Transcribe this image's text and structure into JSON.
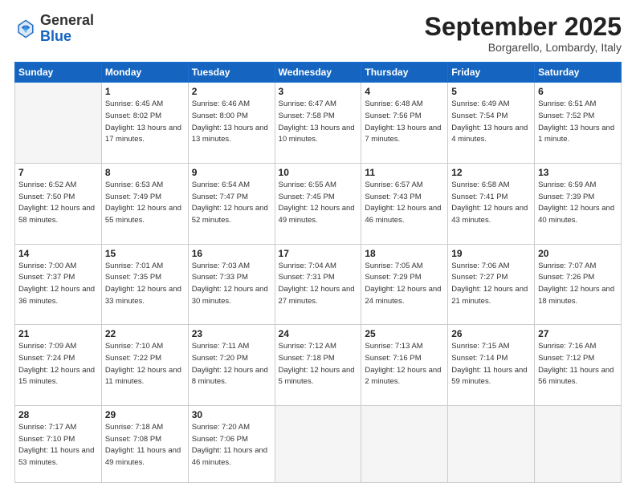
{
  "logo": {
    "text_general": "General",
    "text_blue": "Blue"
  },
  "title": "September 2025",
  "location": "Borgarello, Lombardy, Italy",
  "weekdays": [
    "Sunday",
    "Monday",
    "Tuesday",
    "Wednesday",
    "Thursday",
    "Friday",
    "Saturday"
  ],
  "weeks": [
    [
      {
        "day": "",
        "empty": true
      },
      {
        "day": "1",
        "sunrise": "Sunrise: 6:45 AM",
        "sunset": "Sunset: 8:02 PM",
        "daylight": "Daylight: 13 hours and 17 minutes."
      },
      {
        "day": "2",
        "sunrise": "Sunrise: 6:46 AM",
        "sunset": "Sunset: 8:00 PM",
        "daylight": "Daylight: 13 hours and 13 minutes."
      },
      {
        "day": "3",
        "sunrise": "Sunrise: 6:47 AM",
        "sunset": "Sunset: 7:58 PM",
        "daylight": "Daylight: 13 hours and 10 minutes."
      },
      {
        "day": "4",
        "sunrise": "Sunrise: 6:48 AM",
        "sunset": "Sunset: 7:56 PM",
        "daylight": "Daylight: 13 hours and 7 minutes."
      },
      {
        "day": "5",
        "sunrise": "Sunrise: 6:49 AM",
        "sunset": "Sunset: 7:54 PM",
        "daylight": "Daylight: 13 hours and 4 minutes."
      },
      {
        "day": "6",
        "sunrise": "Sunrise: 6:51 AM",
        "sunset": "Sunset: 7:52 PM",
        "daylight": "Daylight: 13 hours and 1 minute."
      }
    ],
    [
      {
        "day": "7",
        "sunrise": "Sunrise: 6:52 AM",
        "sunset": "Sunset: 7:50 PM",
        "daylight": "Daylight: 12 hours and 58 minutes."
      },
      {
        "day": "8",
        "sunrise": "Sunrise: 6:53 AM",
        "sunset": "Sunset: 7:49 PM",
        "daylight": "Daylight: 12 hours and 55 minutes."
      },
      {
        "day": "9",
        "sunrise": "Sunrise: 6:54 AM",
        "sunset": "Sunset: 7:47 PM",
        "daylight": "Daylight: 12 hours and 52 minutes."
      },
      {
        "day": "10",
        "sunrise": "Sunrise: 6:55 AM",
        "sunset": "Sunset: 7:45 PM",
        "daylight": "Daylight: 12 hours and 49 minutes."
      },
      {
        "day": "11",
        "sunrise": "Sunrise: 6:57 AM",
        "sunset": "Sunset: 7:43 PM",
        "daylight": "Daylight: 12 hours and 46 minutes."
      },
      {
        "day": "12",
        "sunrise": "Sunrise: 6:58 AM",
        "sunset": "Sunset: 7:41 PM",
        "daylight": "Daylight: 12 hours and 43 minutes."
      },
      {
        "day": "13",
        "sunrise": "Sunrise: 6:59 AM",
        "sunset": "Sunset: 7:39 PM",
        "daylight": "Daylight: 12 hours and 40 minutes."
      }
    ],
    [
      {
        "day": "14",
        "sunrise": "Sunrise: 7:00 AM",
        "sunset": "Sunset: 7:37 PM",
        "daylight": "Daylight: 12 hours and 36 minutes."
      },
      {
        "day": "15",
        "sunrise": "Sunrise: 7:01 AM",
        "sunset": "Sunset: 7:35 PM",
        "daylight": "Daylight: 12 hours and 33 minutes."
      },
      {
        "day": "16",
        "sunrise": "Sunrise: 7:03 AM",
        "sunset": "Sunset: 7:33 PM",
        "daylight": "Daylight: 12 hours and 30 minutes."
      },
      {
        "day": "17",
        "sunrise": "Sunrise: 7:04 AM",
        "sunset": "Sunset: 7:31 PM",
        "daylight": "Daylight: 12 hours and 27 minutes."
      },
      {
        "day": "18",
        "sunrise": "Sunrise: 7:05 AM",
        "sunset": "Sunset: 7:29 PM",
        "daylight": "Daylight: 12 hours and 24 minutes."
      },
      {
        "day": "19",
        "sunrise": "Sunrise: 7:06 AM",
        "sunset": "Sunset: 7:27 PM",
        "daylight": "Daylight: 12 hours and 21 minutes."
      },
      {
        "day": "20",
        "sunrise": "Sunrise: 7:07 AM",
        "sunset": "Sunset: 7:26 PM",
        "daylight": "Daylight: 12 hours and 18 minutes."
      }
    ],
    [
      {
        "day": "21",
        "sunrise": "Sunrise: 7:09 AM",
        "sunset": "Sunset: 7:24 PM",
        "daylight": "Daylight: 12 hours and 15 minutes."
      },
      {
        "day": "22",
        "sunrise": "Sunrise: 7:10 AM",
        "sunset": "Sunset: 7:22 PM",
        "daylight": "Daylight: 12 hours and 11 minutes."
      },
      {
        "day": "23",
        "sunrise": "Sunrise: 7:11 AM",
        "sunset": "Sunset: 7:20 PM",
        "daylight": "Daylight: 12 hours and 8 minutes."
      },
      {
        "day": "24",
        "sunrise": "Sunrise: 7:12 AM",
        "sunset": "Sunset: 7:18 PM",
        "daylight": "Daylight: 12 hours and 5 minutes."
      },
      {
        "day": "25",
        "sunrise": "Sunrise: 7:13 AM",
        "sunset": "Sunset: 7:16 PM",
        "daylight": "Daylight: 12 hours and 2 minutes."
      },
      {
        "day": "26",
        "sunrise": "Sunrise: 7:15 AM",
        "sunset": "Sunset: 7:14 PM",
        "daylight": "Daylight: 11 hours and 59 minutes."
      },
      {
        "day": "27",
        "sunrise": "Sunrise: 7:16 AM",
        "sunset": "Sunset: 7:12 PM",
        "daylight": "Daylight: 11 hours and 56 minutes."
      }
    ],
    [
      {
        "day": "28",
        "sunrise": "Sunrise: 7:17 AM",
        "sunset": "Sunset: 7:10 PM",
        "daylight": "Daylight: 11 hours and 53 minutes."
      },
      {
        "day": "29",
        "sunrise": "Sunrise: 7:18 AM",
        "sunset": "Sunset: 7:08 PM",
        "daylight": "Daylight: 11 hours and 49 minutes."
      },
      {
        "day": "30",
        "sunrise": "Sunrise: 7:20 AM",
        "sunset": "Sunset: 7:06 PM",
        "daylight": "Daylight: 11 hours and 46 minutes."
      },
      {
        "day": "",
        "empty": true
      },
      {
        "day": "",
        "empty": true
      },
      {
        "day": "",
        "empty": true
      },
      {
        "day": "",
        "empty": true
      }
    ]
  ]
}
